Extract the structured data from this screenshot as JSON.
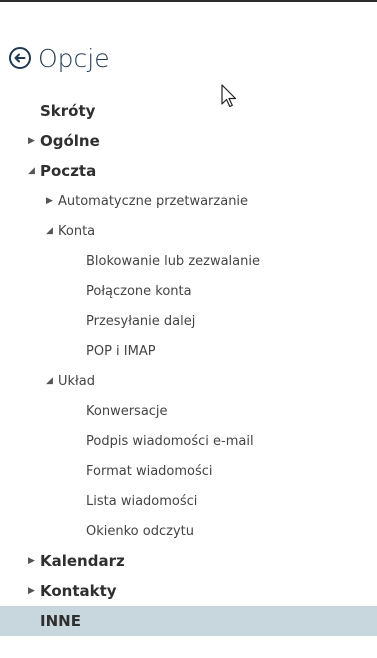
{
  "header": {
    "title": "Opcje",
    "back_icon": "back-arrow-circle-icon"
  },
  "nav": {
    "shortcuts": "Skróty",
    "general": "Ogólne",
    "mail": "Poczta",
    "mail_items": {
      "auto_processing": "Automatyczne przetwarzanie",
      "accounts": "Konta",
      "accounts_children": [
        "Blokowanie lub zezwalanie",
        "Połączone konta",
        "Przesyłanie dalej",
        "POP i IMAP"
      ],
      "layout": "Układ",
      "layout_children": [
        "Konwersacje",
        "Podpis wiadomości e-mail",
        "Format wiadomości",
        "Lista wiadomości",
        "Okienko odczytu"
      ]
    },
    "calendar": "Kalendarz",
    "contacts": "Kontakty",
    "other": "INNE"
  },
  "colors": {
    "selected_background": "#c8d6de",
    "title": "#1f3a52"
  }
}
